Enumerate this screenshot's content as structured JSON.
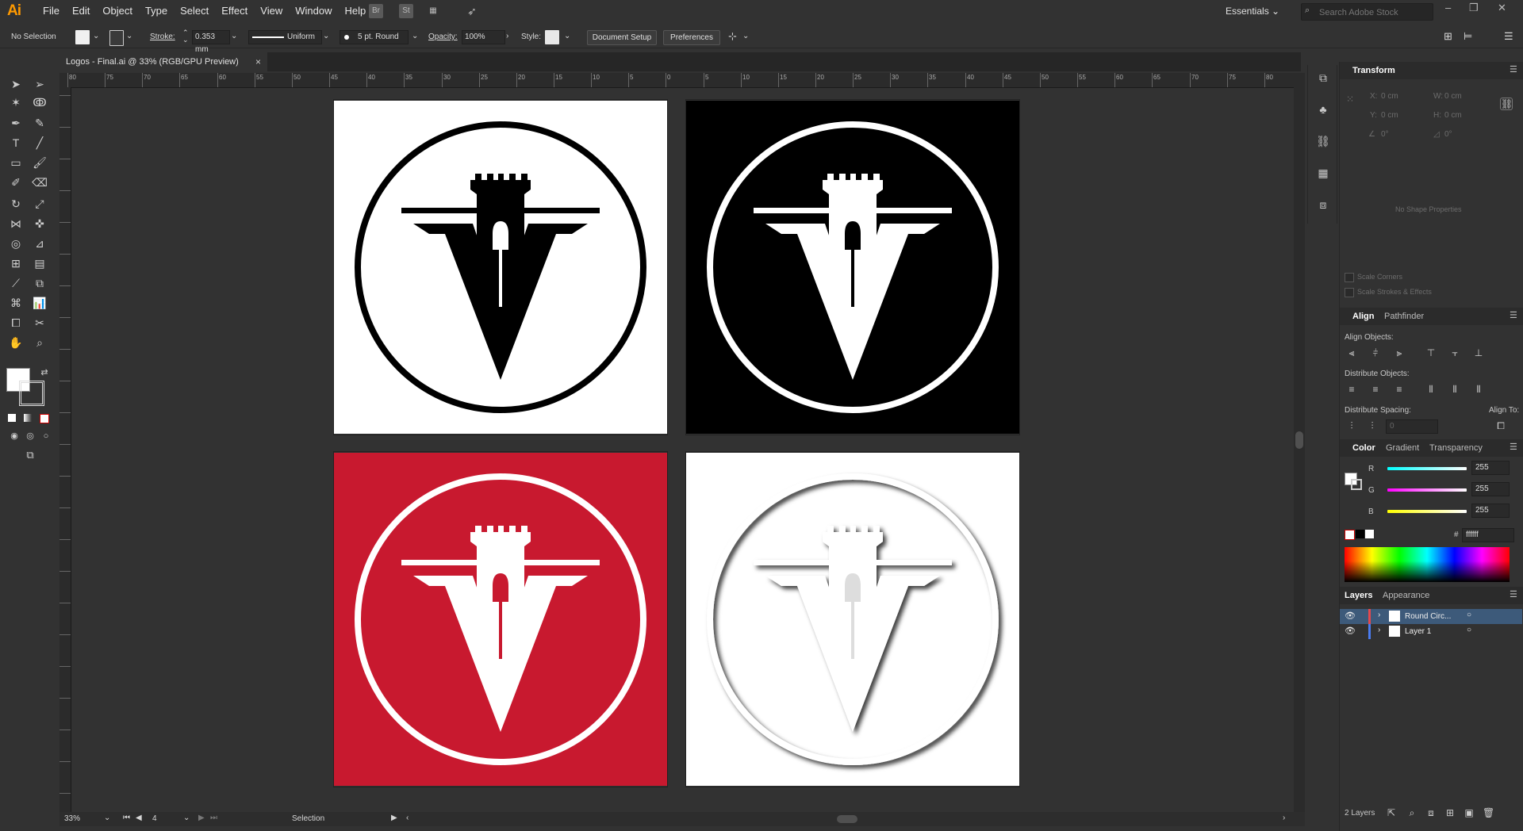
{
  "app": {
    "logo": "Ai"
  },
  "menu": [
    "File",
    "Edit",
    "Object",
    "Type",
    "Select",
    "Effect",
    "View",
    "Window",
    "Help"
  ],
  "menu_extras": {
    "bridge": "Br",
    "stock": "St"
  },
  "workspace": "Essentials",
  "search": {
    "placeholder": "Search Adobe Stock"
  },
  "control": {
    "selection": "No Selection",
    "stroke_label": "Stroke:",
    "stroke_value": "0.353 mm",
    "profile": "Uniform",
    "brush": "5 pt. Round",
    "opacity_label": "Opacity:",
    "opacity_value": "100%",
    "style_label": "Style:",
    "doc_setup": "Document Setup",
    "preferences": "Preferences"
  },
  "document_tab": {
    "title": "Logos - Final.ai @ 33% (RGB/GPU Preview)",
    "close": "×"
  },
  "ruler": {
    "h_ticks": [
      "80",
      "75",
      "70",
      "65",
      "60",
      "55",
      "50",
      "45",
      "40",
      "35",
      "30",
      "25",
      "20",
      "15",
      "10",
      "5",
      "0",
      "5",
      "10",
      "15",
      "20",
      "25",
      "30",
      "35",
      "40",
      "45",
      "50",
      "55",
      "60",
      "65",
      "70",
      "75",
      "80"
    ]
  },
  "artboards": [
    {
      "bg": "#ffffff",
      "fg": "#000000",
      "style": "solid"
    },
    {
      "bg": "#000000",
      "fg": "#ffffff",
      "style": "solid"
    },
    {
      "bg": "#c8192f",
      "fg": "#ffffff",
      "style": "solid"
    },
    {
      "bg": "#ffffff",
      "fg": "#ffffff",
      "style": "emboss"
    }
  ],
  "status": {
    "zoom": "33%",
    "artboard_num": "4",
    "tool": "Selection"
  },
  "transform": {
    "title": "Transform",
    "x_label": "X:",
    "x_val": "0 cm",
    "y_label": "Y:",
    "y_val": "0 cm",
    "w_label": "W:",
    "w_val": "0 cm",
    "h_label": "H:",
    "h_val": "0 cm",
    "angle_val": "0°",
    "shear_val": "0°",
    "empty": "No Shape Properties",
    "scale_corners": "Scale Corners",
    "scale_strokes": "Scale Strokes & Effects"
  },
  "align": {
    "tab_align": "Align",
    "tab_pathfinder": "Pathfinder",
    "align_objects": "Align Objects:",
    "distribute_objects": "Distribute Objects:",
    "distribute_spacing": "Distribute Spacing:",
    "align_to": "Align To:",
    "spacing_val": "0"
  },
  "color": {
    "tab_color": "Color",
    "tab_gradient": "Gradient",
    "tab_transparency": "Transparency",
    "r_label": "R",
    "r_val": "255",
    "g_label": "G",
    "g_val": "255",
    "b_label": "B",
    "b_val": "255",
    "hash": "#",
    "hex": "ffffff"
  },
  "layers": {
    "tab_layers": "Layers",
    "tab_appearance": "Appearance",
    "items": [
      {
        "name": "Round Circ...",
        "color": "#e5484d"
      },
      {
        "name": "Layer 1",
        "color": "#4a7cf0"
      }
    ],
    "count": "2 Layers"
  }
}
